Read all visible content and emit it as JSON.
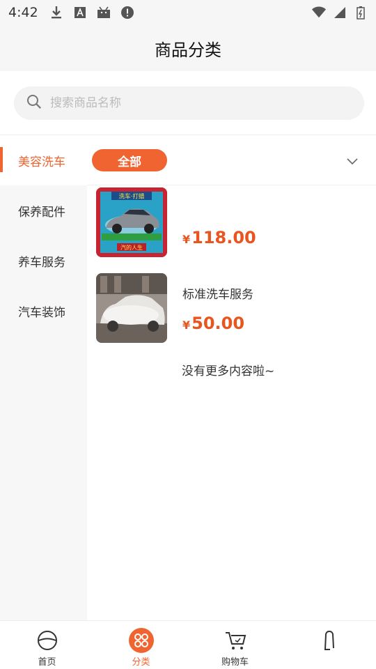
{
  "status_bar": {
    "time": "4:42"
  },
  "header": {
    "title": "商品分类"
  },
  "search": {
    "placeholder": "搜索商品名称"
  },
  "sidebar": {
    "items": [
      {
        "label": "美容洗车",
        "active": true
      },
      {
        "label": "保养配件",
        "active": false
      },
      {
        "label": "养车服务",
        "active": false
      },
      {
        "label": "汽车装饰",
        "active": false
      }
    ]
  },
  "filter": {
    "chip_label": "全部"
  },
  "products": [
    {
      "name": "",
      "price_symbol": "¥",
      "price": "118.00",
      "thumb_caption_top": "洗车·打蜡",
      "thumb_caption_bottom": "汽的人生"
    },
    {
      "name": "标准洗车服务",
      "price_symbol": "¥",
      "price": "50.00"
    }
  ],
  "list_end_text": "没有更多内容啦~",
  "tabbar": {
    "items": [
      {
        "label": "首页",
        "icon": "steering-wheel-icon"
      },
      {
        "label": "分类",
        "icon": "category-grid-icon",
        "active": true
      },
      {
        "label": "购物车",
        "icon": "cart-icon"
      },
      {
        "label": "",
        "icon": "user-icon"
      }
    ]
  },
  "colors": {
    "accent": "#f06431",
    "price": "#e8551f",
    "background": "#f6f6f6"
  }
}
